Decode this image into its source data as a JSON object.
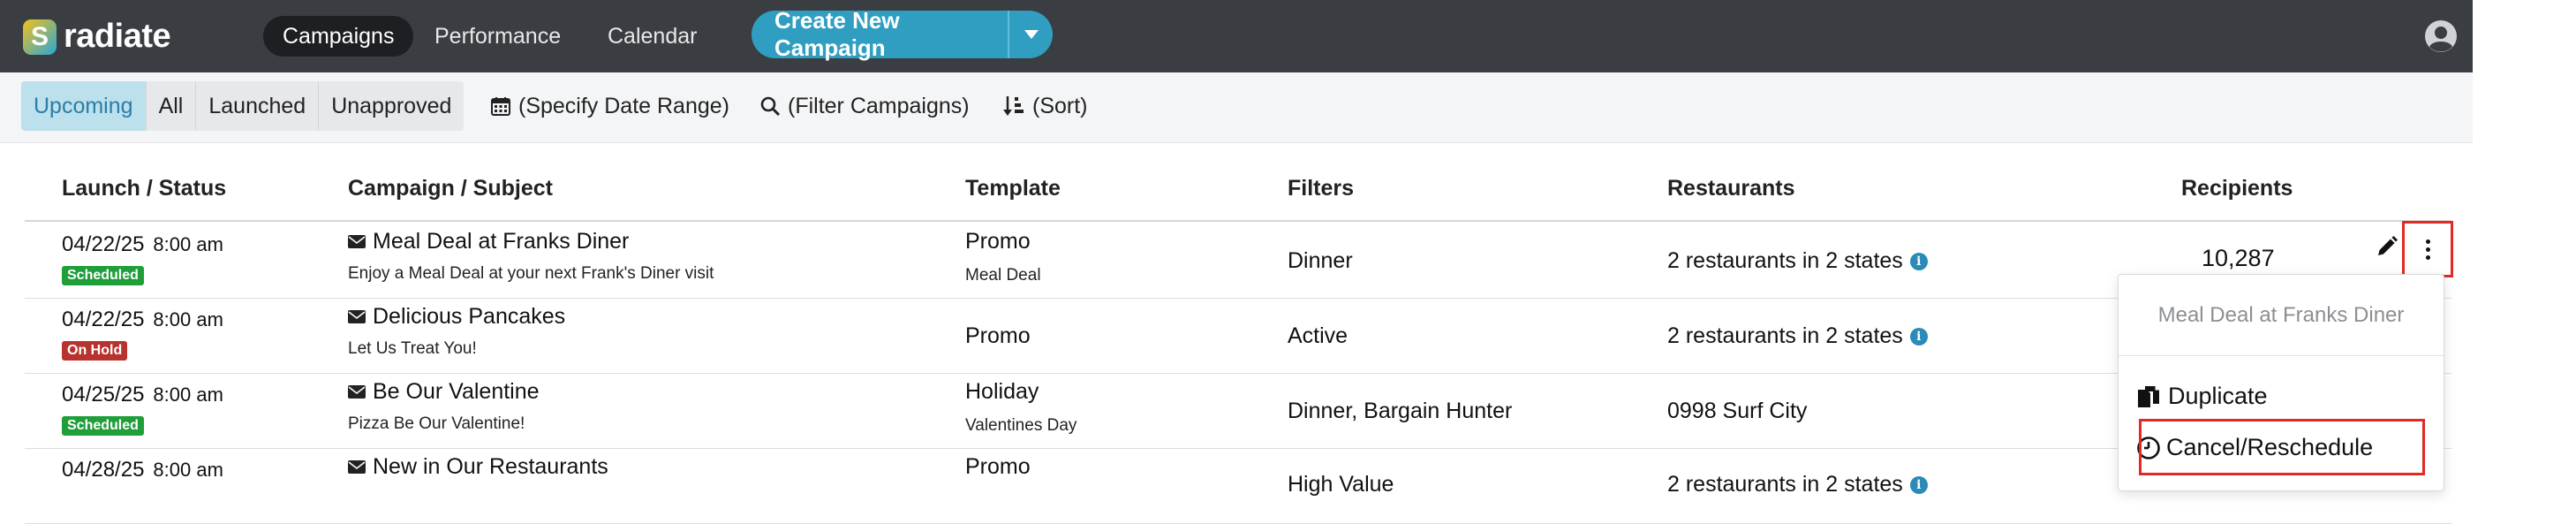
{
  "nav": {
    "brand": "radiate",
    "items": [
      {
        "label": "Campaigns",
        "active": true
      },
      {
        "label": "Performance",
        "active": false
      },
      {
        "label": "Calendar",
        "active": false
      }
    ],
    "create_button": "Create New Campaign"
  },
  "filterbar": {
    "segments": [
      {
        "label": "Upcoming",
        "active": true
      },
      {
        "label": "All",
        "active": false
      },
      {
        "label": "Launched",
        "active": false
      },
      {
        "label": "Unapproved",
        "active": false
      }
    ],
    "date_range": "(Specify Date Range)",
    "filter": "(Filter Campaigns)",
    "sort": "(Sort)"
  },
  "table": {
    "headers": {
      "launch": "Launch / Status",
      "campaign": "Campaign / Subject",
      "template": "Template",
      "filters": "Filters",
      "restaurants": "Restaurants",
      "recipients": "Recipients"
    },
    "rows": [
      {
        "date": "04/22/25",
        "time": "8:00 am",
        "status": "Scheduled",
        "title": "Meal Deal at Franks Diner",
        "subject": "Enjoy a Meal Deal at your next Frank's Diner visit",
        "template": "Promo",
        "template_sub": "Meal Deal",
        "filters": "Dinner",
        "restaurants": "2 restaurants in 2 states",
        "recipients": "10,287"
      },
      {
        "date": "04/22/25",
        "time": "8:00 am",
        "status": "On Hold",
        "title": "Delicious Pancakes",
        "subject": "Let Us Treat You!",
        "template": "Promo",
        "template_sub": "",
        "filters": "Active",
        "restaurants": "2 restaurants in 2 states",
        "recipients": ""
      },
      {
        "date": "04/25/25",
        "time": "8:00 am",
        "status": "Scheduled",
        "title": "Be Our Valentine",
        "subject": "Pizza Be Our Valentine!",
        "template": "Holiday",
        "template_sub": "Valentines Day",
        "filters": "Dinner, Bargain Hunter",
        "restaurants": "0998 Surf City",
        "recipients": ""
      },
      {
        "date": "04/28/25",
        "time": "8:00 am",
        "status": "",
        "title": "New in Our Restaurants",
        "subject": "",
        "template": "Promo",
        "template_sub": "",
        "filters": "High Value",
        "restaurants": "2 restaurants in 2 states",
        "recipients": ""
      }
    ]
  },
  "menu": {
    "header": "Meal Deal at Franks Diner",
    "duplicate": "Duplicate",
    "cancel": "Cancel/Reschedule"
  },
  "colors": {
    "navbar": "#3a3d42",
    "accent": "#2f9ec0",
    "scheduled": "#1f9e3a",
    "on_hold": "#b8322e",
    "highlight": "#e02a22"
  }
}
